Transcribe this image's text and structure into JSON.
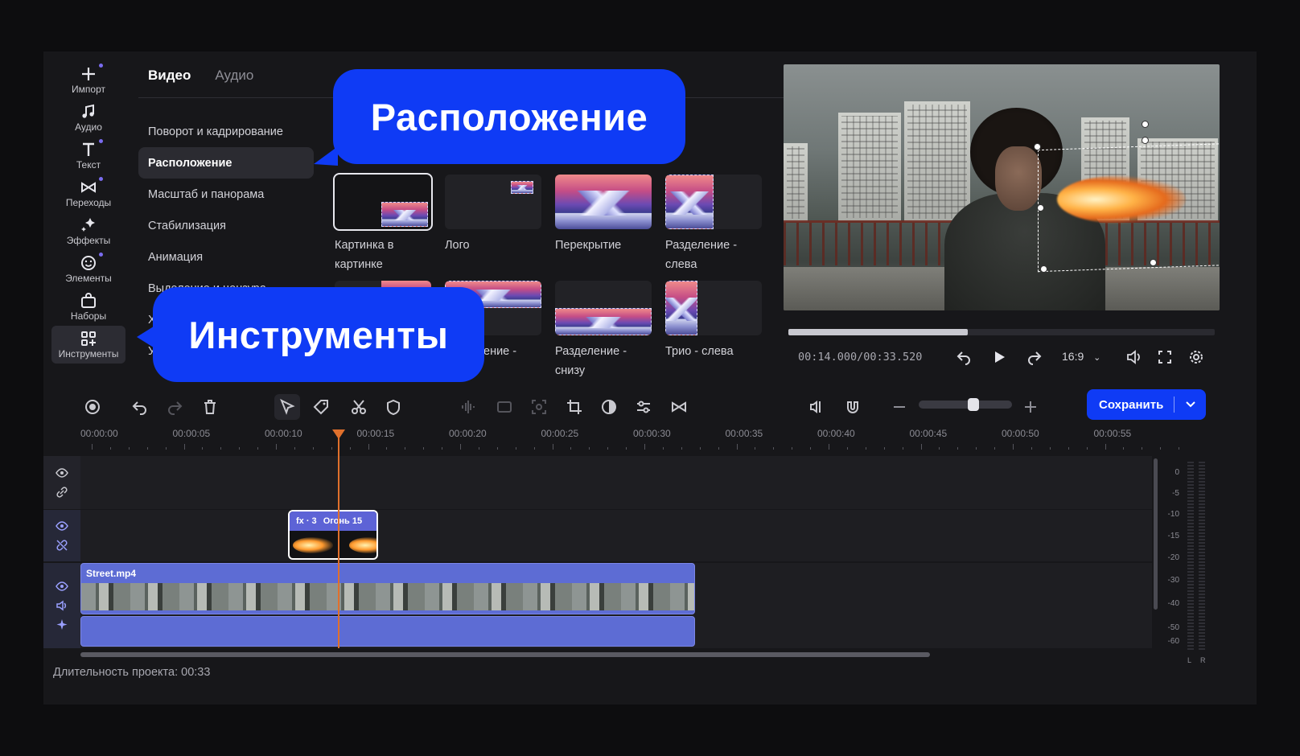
{
  "sidebar": {
    "items": [
      {
        "label": "Импорт",
        "icon": "plus-icon",
        "dot": true
      },
      {
        "label": "Аудио",
        "icon": "music-note-icon",
        "dot": false
      },
      {
        "label": "Текст",
        "icon": "text-icon",
        "dot": true
      },
      {
        "label": "Переходы",
        "icon": "transition-icon",
        "dot": true
      },
      {
        "label": "Эффекты",
        "icon": "sparkle-icon",
        "dot": false
      },
      {
        "label": "Элементы",
        "icon": "smiley-icon",
        "dot": true
      },
      {
        "label": "Наборы",
        "icon": "bag-icon",
        "dot": false
      },
      {
        "label": "Инструменты",
        "icon": "grid-plus-icon",
        "dot": false,
        "active": true
      }
    ]
  },
  "subtabs": {
    "video": "Видео",
    "audio": "Аудио"
  },
  "menu": {
    "items": [
      "Поворот и кадрирование",
      "Расположение",
      "Масштаб и панорама",
      "Стабилизация",
      "Анимация",
      "Выделение и цензура",
      "Х",
      "У"
    ]
  },
  "layouts": [
    {
      "label": "Картинка в картинке"
    },
    {
      "label": "Лого"
    },
    {
      "label": "Перекрытие"
    },
    {
      "label": "Разделение - слева"
    },
    {
      "label": ""
    },
    {
      "label": "ение -"
    },
    {
      "label": "Разделение - снизу"
    },
    {
      "label": "Трио - слева"
    }
  ],
  "callouts": {
    "layout": "Расположение",
    "tools": "Инструменты"
  },
  "player": {
    "timecode": "00:14.000/00:33.520",
    "progress": 0.42,
    "aspect": "16:9"
  },
  "toolbar": {
    "save_label": "Сохранить",
    "zoom": 0.6
  },
  "ruler": {
    "labels": [
      "00:00:00",
      "00:00:05",
      "00:00:10",
      "00:00:15",
      "00:00:20",
      "00:00:25",
      "00:00:30",
      "00:00:35",
      "00:00:40",
      "00:00:45",
      "00:00:50",
      "00:00:55"
    ]
  },
  "clips": {
    "fx_badge": "fx · 3",
    "fx_name": "Огонь 15",
    "video_name": "Street.mp4"
  },
  "meter": {
    "labels": [
      "0",
      "-5",
      "-10",
      "-15",
      "-20",
      "-30",
      "-40",
      "-50",
      "-60"
    ],
    "left": "L",
    "right": "R"
  },
  "status": "Длительность проекта: 00:33",
  "colors": {
    "accent": "#0f3bf5",
    "clip": "#5d6cd4",
    "playhead": "#e0702c"
  }
}
